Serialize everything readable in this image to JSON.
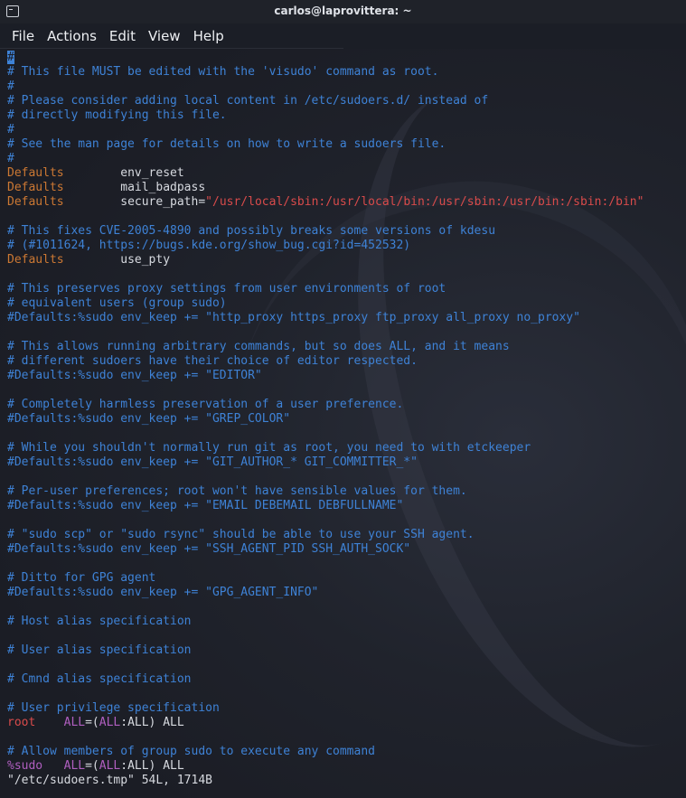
{
  "window": {
    "title": "carlos@laprovittera: ~"
  },
  "menu": [
    "File",
    "Actions",
    "Edit",
    "View",
    "Help"
  ],
  "lines": [
    [
      [
        "cursor",
        "#"
      ]
    ],
    [
      [
        "cm",
        "# This file MUST be edited with the 'visudo' command as root."
      ]
    ],
    [
      [
        "cm",
        "#"
      ]
    ],
    [
      [
        "cm",
        "# Please consider adding local content in /etc/sudoers.d/ instead of"
      ]
    ],
    [
      [
        "cm",
        "# directly modifying this file."
      ]
    ],
    [
      [
        "cm",
        "#"
      ]
    ],
    [
      [
        "cm",
        "# See the man page for details on how to write a sudoers file."
      ]
    ],
    [
      [
        "cm",
        "#"
      ]
    ],
    [
      [
        "kw",
        "Defaults"
      ],
      [
        "txt",
        "        env_reset"
      ]
    ],
    [
      [
        "kw",
        "Defaults"
      ],
      [
        "txt",
        "        mail_badpass"
      ]
    ],
    [
      [
        "kw",
        "Defaults"
      ],
      [
        "txt",
        "        secure_path="
      ],
      [
        "str",
        "\"/usr/local/sbin:/usr/local/bin:/usr/sbin:/usr/bin:/sbin:/bin\""
      ]
    ],
    [],
    [
      [
        "cm",
        "# This fixes CVE-2005-4890 and possibly breaks some versions of kdesu"
      ]
    ],
    [
      [
        "cm",
        "# (#1011624, https://bugs.kde.org/show_bug.cgi?id=452532)"
      ]
    ],
    [
      [
        "kw",
        "Defaults"
      ],
      [
        "txt",
        "        use_pty"
      ]
    ],
    [],
    [
      [
        "cm",
        "# This preserves proxy settings from user environments of root"
      ]
    ],
    [
      [
        "cm",
        "# equivalent users (group sudo)"
      ]
    ],
    [
      [
        "cm",
        "#Defaults:%sudo env_keep += \"http_proxy https_proxy ftp_proxy all_proxy no_proxy\""
      ]
    ],
    [],
    [
      [
        "cm",
        "# This allows running arbitrary commands, but so does ALL, and it means"
      ]
    ],
    [
      [
        "cm",
        "# different sudoers have their choice of editor respected."
      ]
    ],
    [
      [
        "cm",
        "#Defaults:%sudo env_keep += \"EDITOR\""
      ]
    ],
    [],
    [
      [
        "cm",
        "# Completely harmless preservation of a user preference."
      ]
    ],
    [
      [
        "cm",
        "#Defaults:%sudo env_keep += \"GREP_COLOR\""
      ]
    ],
    [],
    [
      [
        "cm",
        "# While you shouldn't normally run git as root, you need to with etckeeper"
      ]
    ],
    [
      [
        "cm",
        "#Defaults:%sudo env_keep += \"GIT_AUTHOR_* GIT_COMMITTER_*\""
      ]
    ],
    [],
    [
      [
        "cm",
        "# Per-user preferences; root won't have sensible values for them."
      ]
    ],
    [
      [
        "cm",
        "#Defaults:%sudo env_keep += \"EMAIL DEBEMAIL DEBFULLNAME\""
      ]
    ],
    [],
    [
      [
        "cm",
        "# \"sudo scp\" or \"sudo rsync\" should be able to use your SSH agent."
      ]
    ],
    [
      [
        "cm",
        "#Defaults:%sudo env_keep += \"SSH_AGENT_PID SSH_AUTH_SOCK\""
      ]
    ],
    [],
    [
      [
        "cm",
        "# Ditto for GPG agent"
      ]
    ],
    [
      [
        "cm",
        "#Defaults:%sudo env_keep += \"GPG_AGENT_INFO\""
      ]
    ],
    [],
    [
      [
        "cm",
        "# Host alias specification"
      ]
    ],
    [],
    [
      [
        "cm",
        "# User alias specification"
      ]
    ],
    [],
    [
      [
        "cm",
        "# Cmnd alias specification"
      ]
    ],
    [],
    [
      [
        "cm",
        "# User privilege specification"
      ]
    ],
    [
      [
        "str",
        "root"
      ],
      [
        "txt",
        "    "
      ],
      [
        "grp",
        "ALL"
      ],
      [
        "txt",
        "=("
      ],
      [
        "grp",
        "ALL"
      ],
      [
        "txt",
        ":ALL) ALL"
      ]
    ],
    [],
    [
      [
        "cm",
        "# Allow members of group sudo to execute any command"
      ]
    ],
    [
      [
        "grp",
        "%sudo"
      ],
      [
        "txt",
        "   "
      ],
      [
        "grp",
        "ALL"
      ],
      [
        "txt",
        "=("
      ],
      [
        "grp",
        "ALL"
      ],
      [
        "txt",
        ":ALL) ALL"
      ]
    ],
    [
      [
        "txt",
        "\"/etc/sudoers.tmp\" 54L, 1714B"
      ]
    ]
  ]
}
